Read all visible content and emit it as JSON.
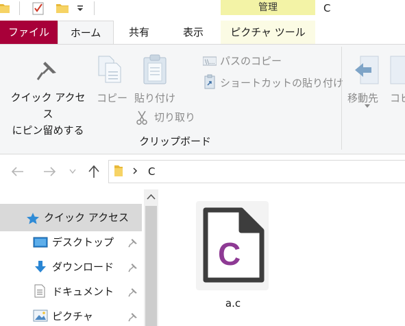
{
  "window": {
    "title": "C",
    "context_tab_header": "管理"
  },
  "tabs": {
    "file": "ファイル",
    "home": "ホーム",
    "share": "共有",
    "view": "表示",
    "picture_tools": "ピクチャ ツール"
  },
  "ribbon": {
    "pin_quick_access": [
      "クイック アクセス",
      "にピン留めする"
    ],
    "copy": "コピー",
    "paste": "貼り付け",
    "copy_path": "パスのコピー",
    "paste_shortcut": "ショートカットの貼り付け",
    "cut": "切り取り",
    "clipboard_group": "クリップボード",
    "move_to": "移動先",
    "copy_to_partial": "コピ"
  },
  "address": {
    "path_segment": "C"
  },
  "nav": {
    "items": [
      {
        "label": "クイック アクセス",
        "icon": "star-icon",
        "pinned": false,
        "selected": true
      },
      {
        "label": "デスクトップ",
        "icon": "desktop-icon",
        "pinned": true
      },
      {
        "label": "ダウンロード",
        "icon": "download-icon",
        "pinned": true
      },
      {
        "label": "ドキュメント",
        "icon": "document-icon",
        "pinned": true
      },
      {
        "label": "ピクチャ",
        "icon": "pictures-icon",
        "pinned": true
      }
    ]
  },
  "files": [
    {
      "name": "a.c",
      "icon": "c-source-file-icon",
      "letter": "C"
    }
  ],
  "colors": {
    "file_tab": "#a80039",
    "context_header": "#f3f3a6",
    "c_letter": "#8e3a94",
    "selection": "#d9d9d9"
  }
}
